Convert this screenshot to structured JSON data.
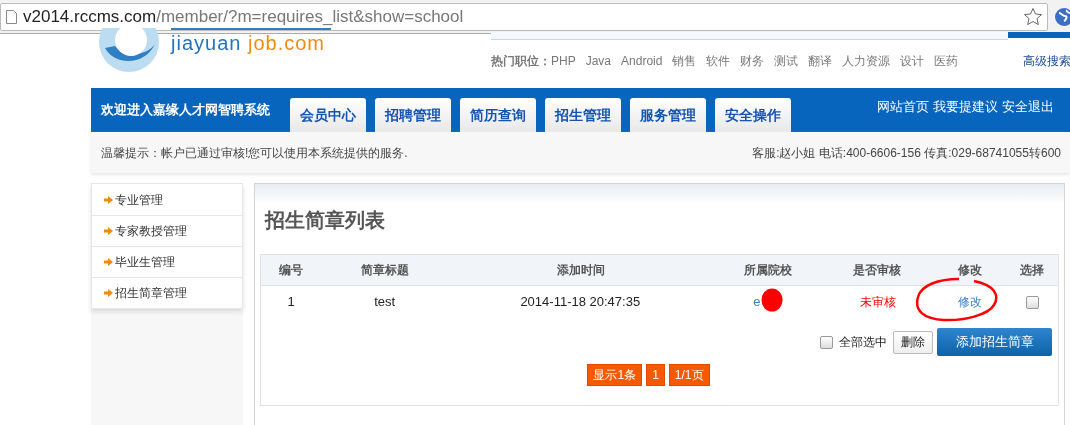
{
  "browser": {
    "url_host": "v2014.rccms.com",
    "url_path": "/member/?m=requires_list&show=school"
  },
  "logo": {
    "left": "jiayuan",
    "right": "job.com"
  },
  "hot_jobs": {
    "label": "热门职位：",
    "items": [
      "PHP",
      "Java",
      "Android",
      "销售",
      "软件",
      "财务",
      "测试",
      "翻译",
      "人力资源",
      "设计",
      "医药"
    ]
  },
  "advanced_search": "高级搜索",
  "nav": {
    "welcome": "欢迎进入嘉缘人才网智聘系统",
    "tabs": [
      {
        "label": "会员中心",
        "selected": false
      },
      {
        "label": "招聘管理",
        "selected": false
      },
      {
        "label": "简历查询",
        "selected": false
      },
      {
        "label": "招生管理",
        "selected": false
      },
      {
        "label": "服务管理",
        "selected": false
      },
      {
        "label": "安全操作",
        "selected": false
      }
    ],
    "links": [
      "网站首页",
      "我要提建议",
      "安全退出"
    ]
  },
  "notice": {
    "text": "温馨提示：帐户已通过审核!您可以使用本系统提供的服务.",
    "contact": "客服:赵小姐 电话:400-6606-156 传真:029-68741055转600"
  },
  "sidebar": [
    {
      "label": "专业管理",
      "selected": false
    },
    {
      "label": "专家教授管理",
      "selected": false
    },
    {
      "label": "毕业生管理",
      "selected": false
    },
    {
      "label": "招生简章管理",
      "selected": false
    }
  ],
  "page_title": "招生简章列表",
  "table": {
    "columns": [
      "编号",
      "简章标题",
      "添加时间",
      "所属院校",
      "是否审核",
      "修改",
      "选择"
    ],
    "rows": [
      {
        "id": "1",
        "title": "test",
        "added": "2014-11-18 20:47:35",
        "school": "e",
        "review": "未审核",
        "edit": "修改",
        "checked": false
      }
    ]
  },
  "select_all": {
    "label": "全部选中",
    "checked": false
  },
  "buttons": {
    "delete": "删除",
    "add": "添加招生简章"
  },
  "pagination": [
    "显示1条",
    "1",
    "1/1页"
  ]
}
